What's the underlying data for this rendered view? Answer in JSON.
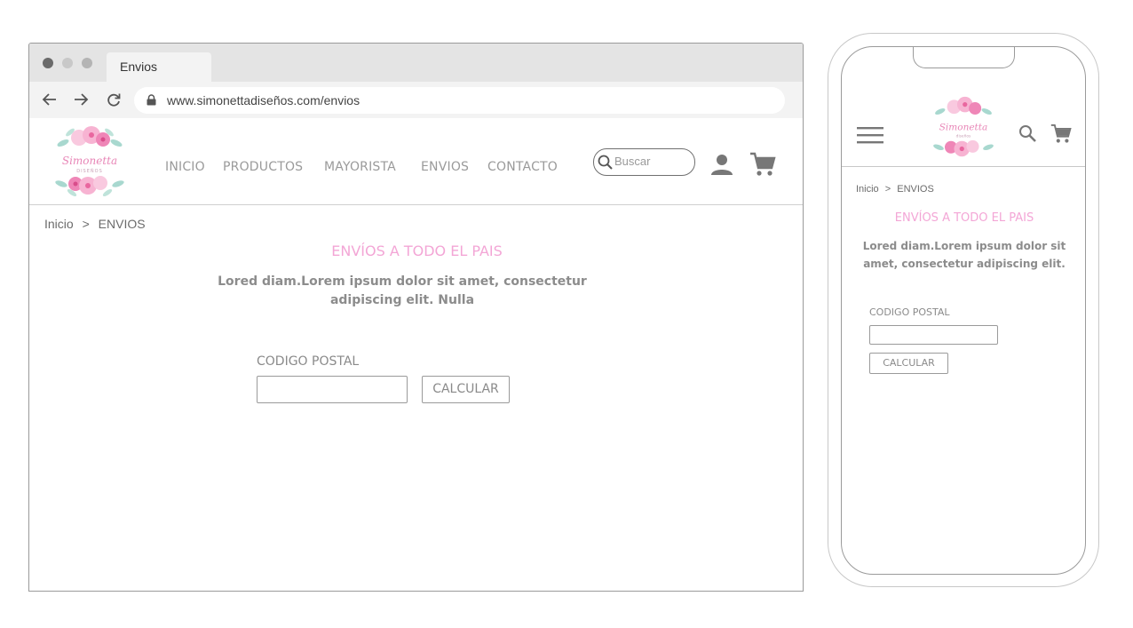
{
  "browser": {
    "tab_title": "Envios",
    "url": "www.simonettadiseños.com/envios",
    "window_dots": [
      "#6a6a6a",
      "#c8c8c8",
      "#b4b4b4"
    ]
  },
  "brand": {
    "name": "Simonetta",
    "tagline_desktop": "DISEÑOS",
    "tagline_mobile": "diseños",
    "pink": "#f3a6d6"
  },
  "nav": {
    "items": [
      "INICIO",
      "PRODUCTOS",
      "MAYORISTA",
      "ENVIOS",
      "CONTACTO"
    ],
    "search_placeholder": "Buscar"
  },
  "breadcrumb": {
    "home": "Inicio",
    "separator": ">",
    "current": "ENVIOS"
  },
  "content": {
    "title": "ENVÍOS A TODO EL PAIS",
    "desc_line1": "Lored diam.Lorem ipsum dolor sit amet, consectetur",
    "desc_line2": "adipiscing elit. Nulla",
    "postal_label": "CODIGO POSTAL",
    "calc_button": "CALCULAR"
  },
  "mobile": {
    "desc_line1": "Lored diam.Lorem ipsum dolor sit",
    "desc_line2": "amet, consectetur adipiscing elit."
  },
  "icons": {
    "back": "arrow-left-icon",
    "forward": "arrow-right-icon",
    "reload": "reload-icon",
    "lock": "lock-icon",
    "search": "search-icon",
    "user": "user-icon",
    "cart": "cart-icon",
    "menu": "hamburger-icon"
  }
}
